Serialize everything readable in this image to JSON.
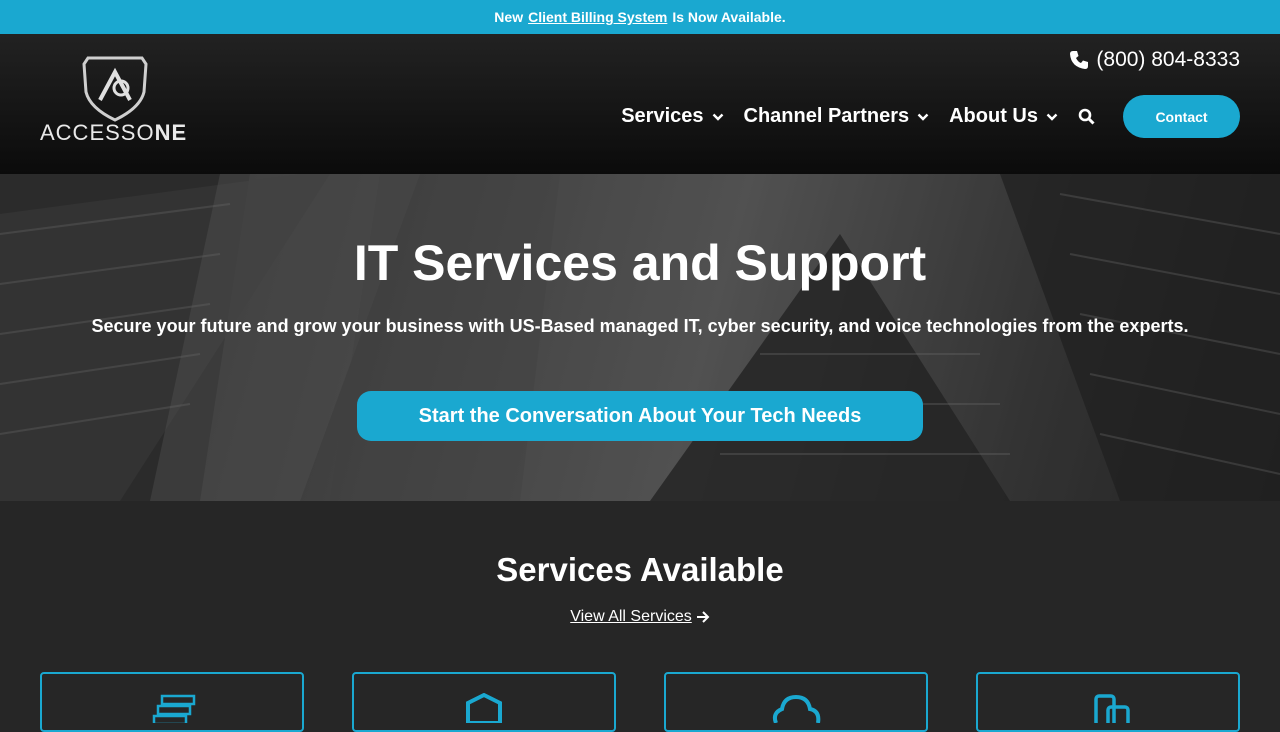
{
  "announcement": {
    "prefix": "New",
    "link": "Client Billing System",
    "suffix": "Is Now Available."
  },
  "header": {
    "logo": {
      "name_light": "ACCESS",
      "name_o": "O",
      "name_bold": "NE"
    },
    "phone": "(800) 804-8333",
    "nav": [
      {
        "label": "Services",
        "icon": "chevron-down-icon"
      },
      {
        "label": "Channel Partners",
        "icon": "chevron-down-icon"
      },
      {
        "label": "About Us",
        "icon": "chevron-down-icon"
      }
    ],
    "search_icon": "search-icon",
    "contact_label": "Contact"
  },
  "hero": {
    "title": "IT Services and Support",
    "subtitle": "Secure your future and grow your business with US-Based managed IT, cyber security, and voice technologies from the experts.",
    "cta": "Start the Conversation About Your Tech Needs"
  },
  "services": {
    "title": "Services Available",
    "view_all": "View All Services",
    "cards": [
      {
        "icon": "server-icon"
      },
      {
        "icon": "shield-check-icon"
      },
      {
        "icon": "cloud-icon"
      },
      {
        "icon": "phone-devices-icon"
      }
    ]
  },
  "colors": {
    "accent": "#1aa8d0",
    "background": "#262626",
    "header": "#111111"
  }
}
